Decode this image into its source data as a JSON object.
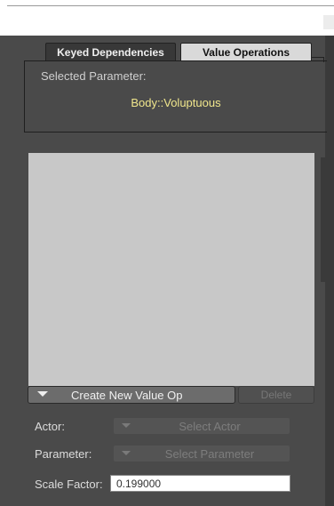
{
  "tabs": {
    "keyed_dependencies": "Keyed Dependencies",
    "value_operations": "Value Operations"
  },
  "selected": {
    "label": "Selected Parameter:",
    "value": "Body::Voluptuous"
  },
  "buttons": {
    "create_new_value_op": "Create New Value Op",
    "delete": "Delete"
  },
  "fields": {
    "actor_label": "Actor:",
    "actor_select": "Select Actor",
    "parameter_label": "Parameter:",
    "parameter_select": "Select Parameter",
    "scale_factor_label": "Scale Factor:",
    "scale_factor_value": "0.199000"
  },
  "colors": {
    "panel_bg": "#4a4a4a",
    "selected_value_text": "#f0e68c",
    "list_bg": "#c8c8c8"
  },
  "icons": {
    "create_dropdown": "triangle-down-icon",
    "actor_dropdown": "triangle-down-icon",
    "parameter_dropdown": "triangle-down-icon"
  }
}
